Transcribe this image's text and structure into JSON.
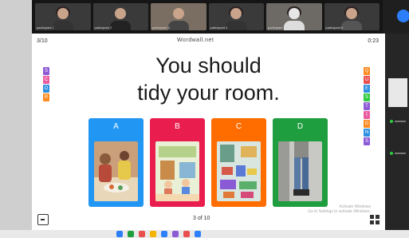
{
  "participants": [
    {
      "name": "participant 1"
    },
    {
      "name": "participant 2"
    },
    {
      "name": "participant 3"
    },
    {
      "name": "participant 4"
    },
    {
      "name": "participant 5"
    },
    {
      "name": "participant 6"
    }
  ],
  "slide": {
    "top_left": "3/10",
    "top_center": "Wordwall.net",
    "top_right": "0:23",
    "prompt_line1": "You should",
    "prompt_line2": "tidy your room.",
    "left_letters": [
      "S",
      "C",
      "O",
      "R"
    ],
    "right_letters": [
      "Q",
      "U",
      "E",
      "S",
      "T",
      "I",
      "O",
      "N",
      "S"
    ],
    "options": [
      {
        "label": "A",
        "color": "#2196f3",
        "picture": "family-meal-photo"
      },
      {
        "label": "B",
        "color": "#e91e4f",
        "picture": "cartoon-cleaning-picture"
      },
      {
        "label": "C",
        "color": "#ff6d00",
        "picture": "messy-room-picture"
      },
      {
        "label": "D",
        "color": "#1e9e3e",
        "picture": "person-jeans-photo"
      }
    ],
    "pager": "3 of 10",
    "watermark_line1": "Activate Windows",
    "watermark_line2": "Go to Settings to activate Windows."
  },
  "colors": {
    "letter_left": [
      "#8e5bd6",
      "#e95c9f",
      "#2e8fe0",
      "#ff8a1e"
    ],
    "letter_right": [
      "#ff8a1e",
      "#e94f4f",
      "#2e8fe0",
      "#2ecc40",
      "#8e5bd6",
      "#e95c9f",
      "#ff8a1e",
      "#2e8fe0",
      "#8e5bd6"
    ],
    "taskbar_icons": [
      "#2d7ff9",
      "#1e9e3e",
      "#e94f4f",
      "#f4b400",
      "#2d7ff9",
      "#8e5bd6",
      "#e94f4f",
      "#2d7ff9"
    ]
  }
}
